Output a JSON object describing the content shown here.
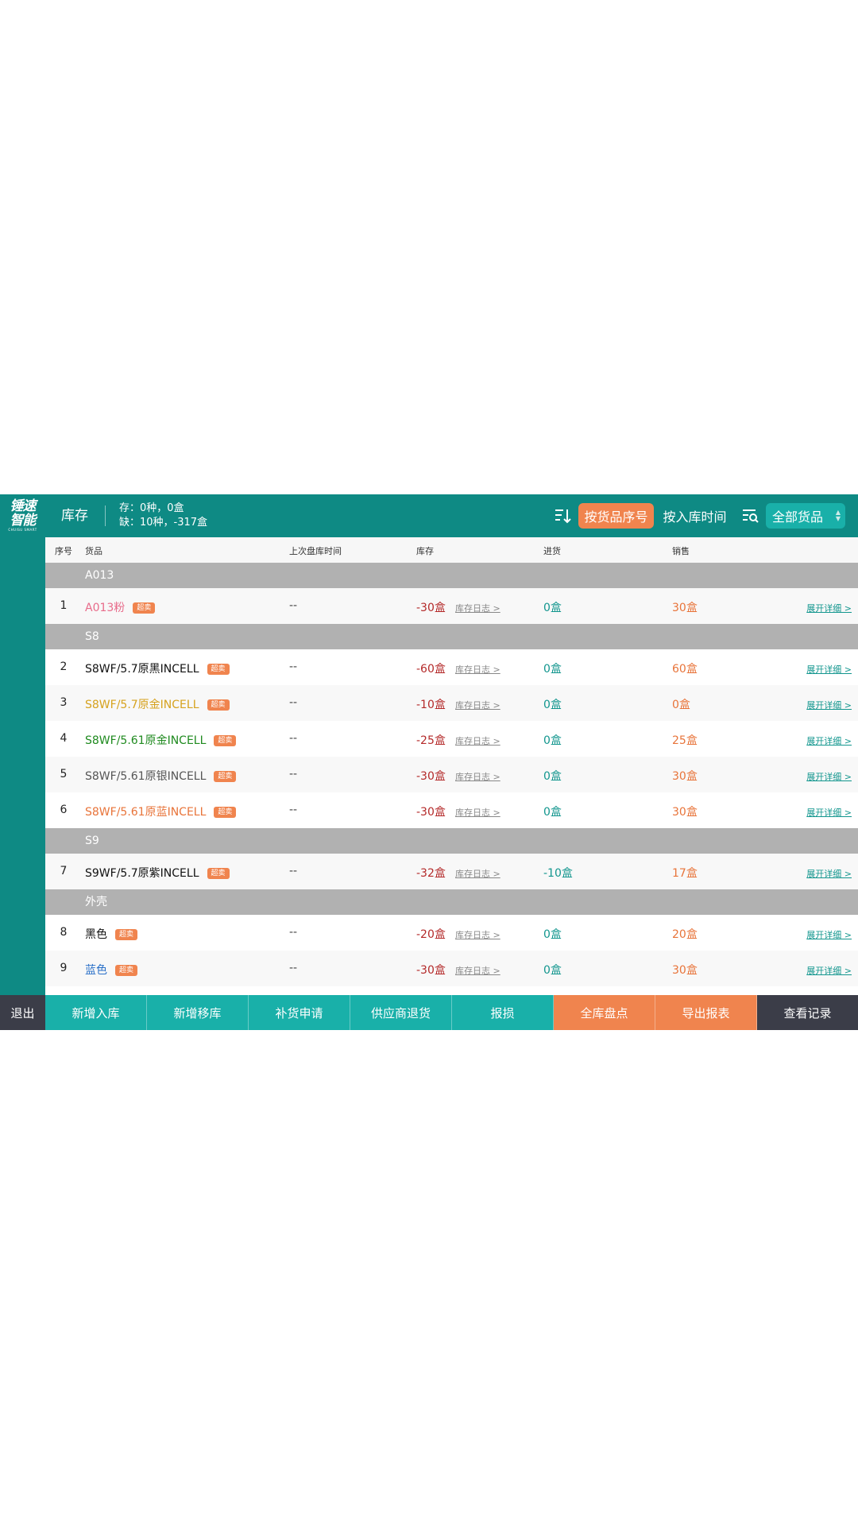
{
  "logo": {
    "line1": "锤速",
    "line2": "智能",
    "sub": "CHUISU SMART"
  },
  "header": {
    "title": "库存",
    "stock_line1": "存：0种，0盒",
    "stock_line2": "缺：10种，-317盒",
    "sort_by_seq": "按货品序号",
    "sort_by_time": "按入库时间",
    "filter": "全部货品"
  },
  "columns": {
    "seq": "序号",
    "product": "货品",
    "last_check": "上次盘库时间",
    "stock": "库存",
    "incoming": "进货",
    "sales": "销售"
  },
  "labels": {
    "tag": "超卖",
    "log": "库存日志 >",
    "detail": "展开详细 >"
  },
  "groups": [
    {
      "name": "A013",
      "rows": [
        {
          "seq": "1",
          "name": "A013粉",
          "color": "#e86b8a",
          "last": "--",
          "stock": "-30盒",
          "incoming": "0盒",
          "sales": "30盒"
        }
      ]
    },
    {
      "name": "S8",
      "rows": [
        {
          "seq": "2",
          "name": "S8WF/5.7原黑INCELL",
          "color": "#111111",
          "last": "--",
          "stock": "-60盒",
          "incoming": "0盒",
          "sales": "60盒"
        },
        {
          "seq": "3",
          "name": "S8WF/5.7原金INCELL",
          "color": "#d6a21e",
          "last": "--",
          "stock": "-10盒",
          "incoming": "0盒",
          "sales": "0盒"
        },
        {
          "seq": "4",
          "name": "S8WF/5.61原金INCELL",
          "color": "#1f8a1f",
          "last": "--",
          "stock": "-25盒",
          "incoming": "0盒",
          "sales": "25盒"
        },
        {
          "seq": "5",
          "name": "S8WF/5.61原银INCELL",
          "color": "#555555",
          "last": "--",
          "stock": "-30盒",
          "incoming": "0盒",
          "sales": "30盒"
        },
        {
          "seq": "6",
          "name": "S8WF/5.61原蓝INCELL",
          "color": "#e8743a",
          "last": "--",
          "stock": "-30盒",
          "incoming": "0盒",
          "sales": "30盒"
        }
      ]
    },
    {
      "name": "S9",
      "rows": [
        {
          "seq": "7",
          "name": "S9WF/5.7原紫INCELL",
          "color": "#111111",
          "last": "--",
          "stock": "-32盒",
          "incoming": "-10盒",
          "sales": "17盒"
        }
      ]
    },
    {
      "name": "外壳",
      "rows": [
        {
          "seq": "8",
          "name": "黑色",
          "color": "#111111",
          "last": "--",
          "stock": "-20盒",
          "incoming": "0盒",
          "sales": "20盒"
        },
        {
          "seq": "9",
          "name": "蓝色",
          "color": "#2a70c8",
          "last": "--",
          "stock": "-30盒",
          "incoming": "0盒",
          "sales": "30盒"
        }
      ]
    }
  ],
  "exit_label": "退出",
  "toolbar": [
    {
      "label": "新增入库",
      "style": "teal",
      "name": "new-stock-in-button"
    },
    {
      "label": "新增移库",
      "style": "teal",
      "name": "new-transfer-button"
    },
    {
      "label": "补货申请",
      "style": "teal",
      "name": "restock-request-button"
    },
    {
      "label": "供应商退货",
      "style": "teal",
      "name": "supplier-return-button"
    },
    {
      "label": "报损",
      "style": "teal",
      "name": "report-loss-button"
    },
    {
      "label": "全库盘点",
      "style": "orange",
      "name": "full-inventory-check-button"
    },
    {
      "label": "导出报表",
      "style": "orange",
      "name": "export-report-button"
    },
    {
      "label": "查看记录",
      "style": "dark",
      "name": "view-records-button"
    }
  ],
  "colors": {
    "brand_teal": "#0e8a84",
    "accent_teal": "#19b0a9",
    "accent_orange": "#f0844e",
    "group_gray": "#b1b1b1",
    "stock_red": "#b42a2a"
  },
  "icons": {
    "sort": "sort-descending-icon",
    "filter": "search-filter-icon",
    "select_arrows": "up-down-arrows-icon"
  }
}
